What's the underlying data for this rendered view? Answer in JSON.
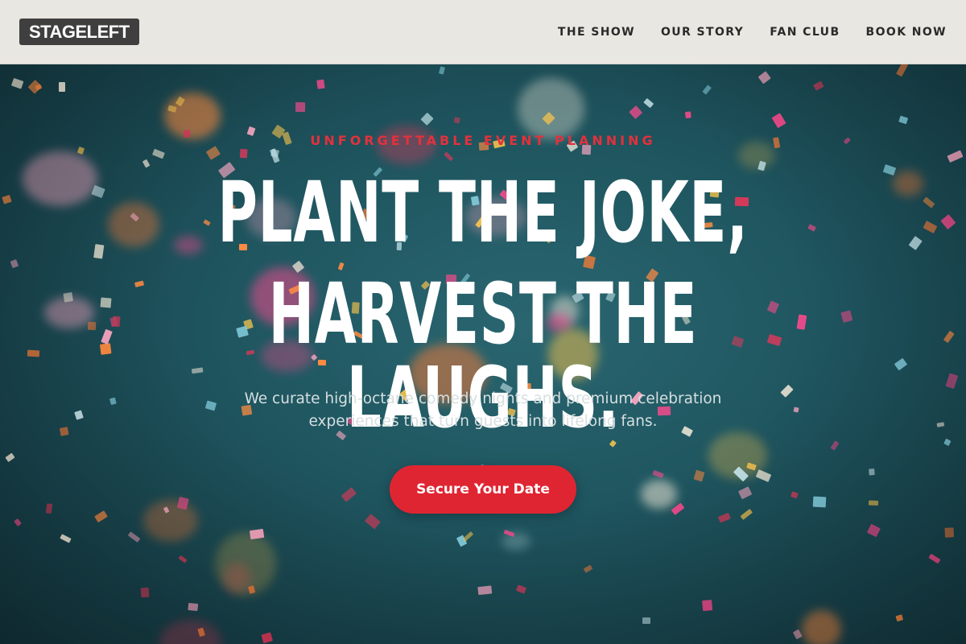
{
  "header": {
    "logo": "STAGELEFT",
    "nav": [
      {
        "label": "THE SHOW"
      },
      {
        "label": "OUR STORY"
      },
      {
        "label": "FAN CLUB"
      },
      {
        "label": "BOOK NOW"
      }
    ]
  },
  "hero": {
    "eyebrow": "UNFORGETTABLE EVENT PLANNING",
    "headline_line1": "PLANT THE JOKE,",
    "headline_line2": "HARVEST THE LAUGHS.",
    "subtext": "We curate high-octane comedy nights and premium celebration experiences that turn guests into lifelong fans.",
    "cta_label": "Secure Your Date",
    "background_image": "confetti-falling-on-teal-background"
  },
  "colors": {
    "header_bg": "#e9e7e1",
    "logo_bg": "#3f3f3f",
    "accent_red": "#e02532",
    "eyebrow_red": "#e3313c",
    "hero_teal": "#1f5660"
  }
}
